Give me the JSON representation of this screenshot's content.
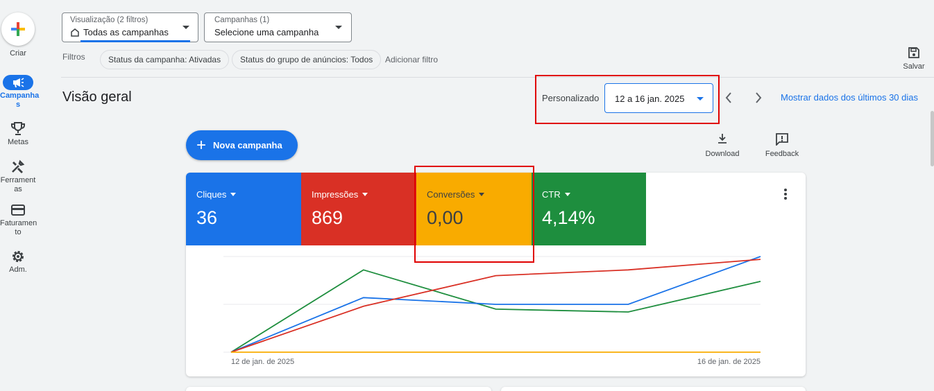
{
  "nav": {
    "create_label": "Criar",
    "items": [
      {
        "label": "Campanha\ns",
        "icon": "megaphone-icon",
        "active": true
      },
      {
        "label": "Metas",
        "icon": "trophy-icon"
      },
      {
        "label": "Ferrament\nas",
        "icon": "tools-icon"
      },
      {
        "label": "Faturamen\nto",
        "icon": "credit-card-icon"
      },
      {
        "label": "Adm.",
        "icon": "gear-icon"
      }
    ]
  },
  "view_selector": {
    "small": "Visualização (2 filtros)",
    "value": "Todas as campanhas"
  },
  "campaign_selector": {
    "small": "Campanhas (1)",
    "value": "Selecione uma campanha"
  },
  "filters": {
    "label": "Filtros",
    "chips": [
      "Status da campanha: Ativadas",
      "Status do grupo de anúncios: Todos"
    ],
    "add": "Adicionar filtro"
  },
  "save_label": "Salvar",
  "page_title": "Visão geral",
  "date": {
    "label": "Personalizado",
    "range": "12 a 16 jan. 2025",
    "last30": "Mostrar dados dos últimos 30 dias"
  },
  "new_campaign_label": "Nova campanha",
  "tools": {
    "download": "Download",
    "feedback": "Feedback"
  },
  "metrics": [
    {
      "name": "Cliques",
      "value": "36",
      "color": "#1a73e8"
    },
    {
      "name": "Impressões",
      "value": "869",
      "color": "#d93025"
    },
    {
      "name": "Conversões",
      "value": "0,00",
      "color": "#f9ab00"
    },
    {
      "name": "CTR",
      "value": "4,14%",
      "color": "#1e8e3e"
    }
  ],
  "chart_data": {
    "type": "line",
    "x": [
      "12 de jan. de 2025",
      "13 de jan. de 2025",
      "14 de jan. de 2025",
      "15 de jan. de 2025",
      "16 de jan. de 2025"
    ],
    "x_tick_labels": [
      "12 de jan. de 2025",
      "16 de jan. de 2025"
    ],
    "normalized": true,
    "ylim": [
      0,
      1
    ],
    "grid": true,
    "series": [
      {
        "name": "Cliques",
        "color": "#1a73e8",
        "values": [
          0,
          0.57,
          0.5,
          0.5,
          1.0
        ]
      },
      {
        "name": "Impressões",
        "color": "#d93025",
        "values": [
          0,
          0.48,
          0.8,
          0.86,
          0.97
        ]
      },
      {
        "name": "Conversões",
        "color": "#f9ab00",
        "values": [
          0,
          0,
          0,
          0,
          0
        ]
      },
      {
        "name": "CTR",
        "color": "#1e8e3e",
        "values": [
          0,
          0.86,
          0.45,
          0.42,
          0.74
        ]
      }
    ]
  }
}
